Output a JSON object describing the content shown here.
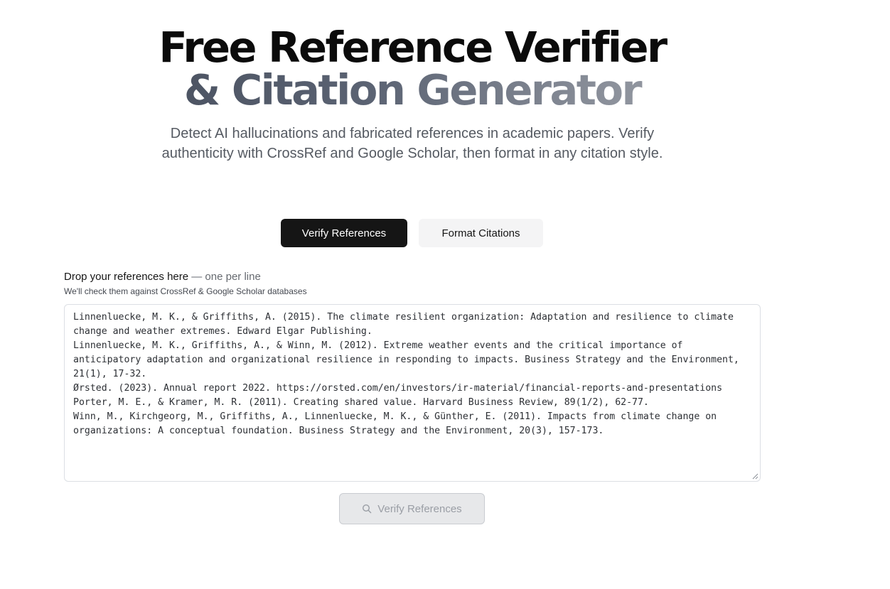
{
  "hero": {
    "title_line1": "Free Reference Verifier",
    "title_line2": "& Citation Generator",
    "subtitle": "Detect AI hallucinations and fabricated references in academic papers. Verify authenticity with CrossRef and Google Scholar, then format in any citation style."
  },
  "tabs": [
    {
      "label": "Verify References",
      "active": true
    },
    {
      "label": "Format Citations",
      "active": false
    }
  ],
  "form": {
    "label_main": "Drop your references here",
    "label_hint": " — one per line",
    "helper": "We'll check them against CrossRef & Google Scholar databases",
    "textarea_value": "Linnenluecke, M. K., & Griffiths, A. (2015). The climate resilient organization: Adaptation and resilience to climate change and weather extremes. Edward Elgar Publishing.\nLinnenluecke, M. K., Griffiths, A., & Winn, M. (2012). Extreme weather events and the critical importance of anticipatory adaptation and organizational resilience in responding to impacts. Business Strategy and the Environment, 21(1), 17-32.\nØrsted. (2023). Annual report 2022. https://orsted.com/en/investors/ir-material/financial-reports-and-presentations\nPorter, M. E., & Kramer, M. R. (2011). Creating shared value. Harvard Business Review, 89(1/2), 62-77.\nWinn, M., Kirchgeorg, M., Griffiths, A., Linnenluecke, M. K., & Günther, E. (2011). Impacts from climate change on organizations: A conceptual foundation. Business Strategy and the Environment, 20(3), 157-173.",
    "submit_label": "Verify References",
    "submit_icon": "search-icon"
  },
  "colors": {
    "primary": "#151515",
    "secondary_bg": "#f4f4f5",
    "disabled_bg": "#e7e8ea",
    "disabled_text": "#9a9ea5"
  }
}
